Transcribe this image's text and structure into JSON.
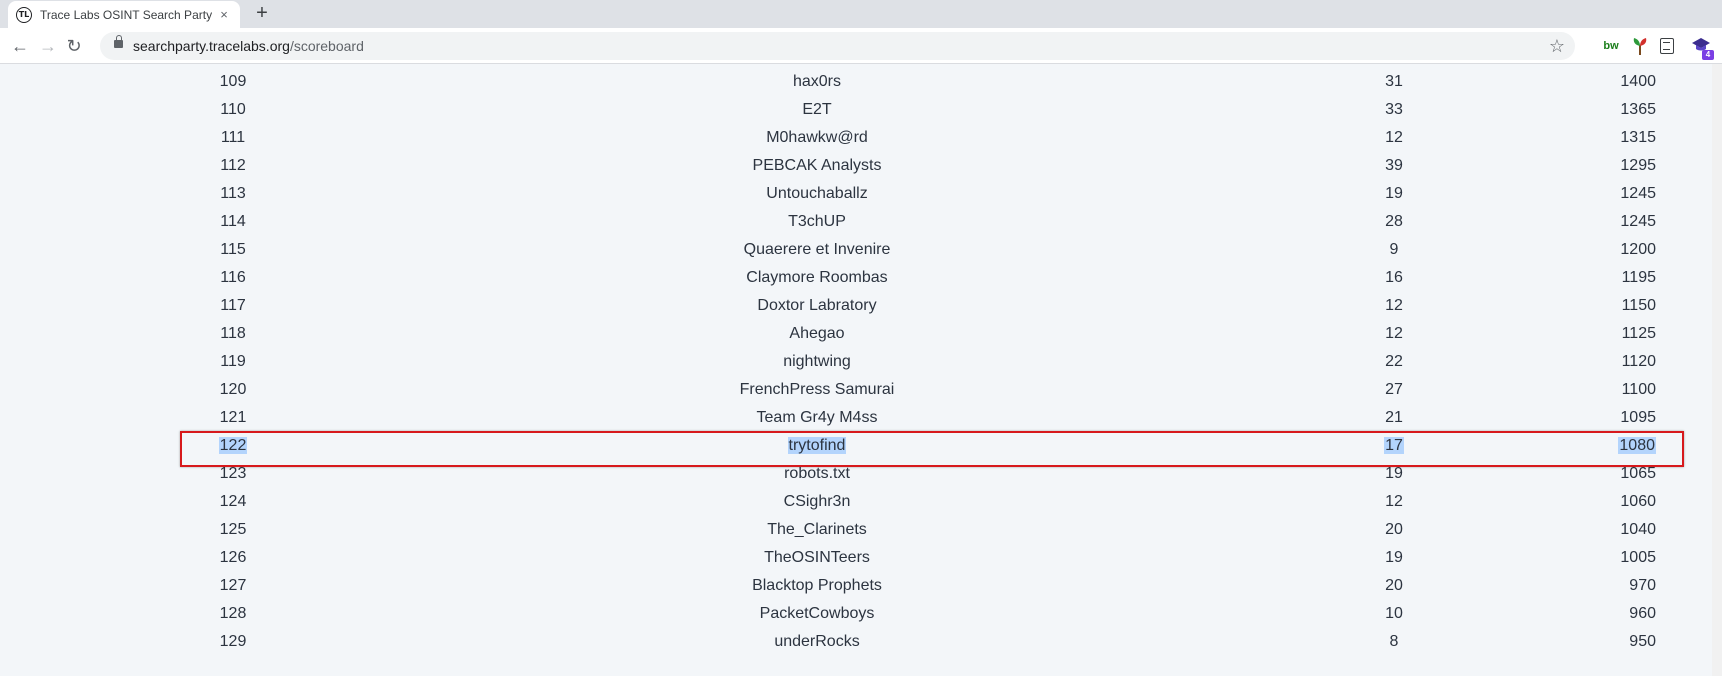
{
  "browser": {
    "tab_title": "Trace Labs OSINT Search Party C",
    "tab_favicon": "TL",
    "tab_close_icon": "×",
    "new_tab_icon": "+",
    "url_host": "searchparty.tracelabs.org",
    "url_path": "/scoreboard",
    "back_icon": "←",
    "forward_icon": "→",
    "reload_icon": "↻",
    "bookmark_icon": "☆",
    "extensions": {
      "bw_label": "bw",
      "kb_badge": "4"
    }
  },
  "scoreboard": {
    "rows": [
      {
        "rank": "109",
        "team": "hax0rs",
        "members": "31",
        "score": "1400"
      },
      {
        "rank": "110",
        "team": "E2T",
        "members": "33",
        "score": "1365"
      },
      {
        "rank": "111",
        "team": "M0hawkw@rd",
        "members": "12",
        "score": "1315"
      },
      {
        "rank": "112",
        "team": "PEBCAK Analysts",
        "members": "39",
        "score": "1295"
      },
      {
        "rank": "113",
        "team": "Untouchaballz",
        "members": "19",
        "score": "1245"
      },
      {
        "rank": "114",
        "team": "T3chUP",
        "members": "28",
        "score": "1245"
      },
      {
        "rank": "115",
        "team": "Quaerere et Invenire",
        "members": "9",
        "score": "1200"
      },
      {
        "rank": "116",
        "team": "Claymore Roombas",
        "members": "16",
        "score": "1195"
      },
      {
        "rank": "117",
        "team": "Doxtor Labratory",
        "members": "12",
        "score": "1150"
      },
      {
        "rank": "118",
        "team": "Ahegao",
        "members": "12",
        "score": "1125"
      },
      {
        "rank": "119",
        "team": "nightwing",
        "members": "22",
        "score": "1120"
      },
      {
        "rank": "120",
        "team": "FrenchPress Samurai",
        "members": "27",
        "score": "1100"
      },
      {
        "rank": "121",
        "team": "Team Gr4y M4ss",
        "members": "21",
        "score": "1095"
      },
      {
        "rank": "122",
        "team": "trytofind",
        "members": "17",
        "score": "1080",
        "selected": true
      },
      {
        "rank": "123",
        "team": "robots.txt",
        "members": "19",
        "score": "1065"
      },
      {
        "rank": "124",
        "team": "CSighr3n",
        "members": "12",
        "score": "1060"
      },
      {
        "rank": "125",
        "team": "The_Clarinets",
        "members": "20",
        "score": "1040"
      },
      {
        "rank": "126",
        "team": "TheOSINTeers",
        "members": "19",
        "score": "1005"
      },
      {
        "rank": "127",
        "team": "Blacktop Prophets",
        "members": "20",
        "score": "970"
      },
      {
        "rank": "128",
        "team": "PacketCowboys",
        "members": "10",
        "score": "960"
      },
      {
        "rank": "129",
        "team": "underRocks",
        "members": "8",
        "score": "950"
      }
    ]
  },
  "colors": {
    "highlight_border": "#d7191c",
    "selection": "#b3d4fc",
    "page_background": "#f3f6f9"
  }
}
